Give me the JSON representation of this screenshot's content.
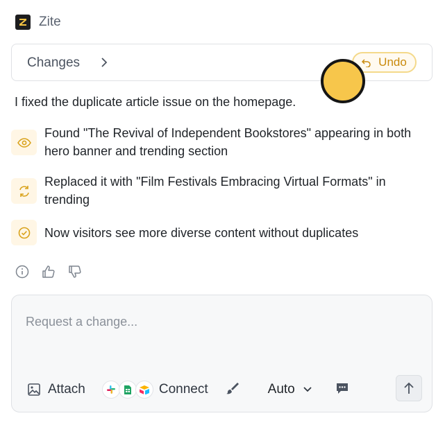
{
  "app": {
    "name": "Zite",
    "logo_icon": "zite-logo-icon"
  },
  "changes": {
    "label": "Changes",
    "undo_label": "Undo"
  },
  "message": {
    "summary": "I fixed the duplicate article issue on the homepage.",
    "items": [
      {
        "icon": "eye-icon",
        "text": "Found \"The Revival of Independent Bookstores\" appearing in both hero banner and trending section"
      },
      {
        "icon": "refresh-icon",
        "text": "Replaced it with \"Film Festivals Embracing Virtual Formats\" in trending"
      },
      {
        "icon": "check-circle-icon",
        "text": "Now visitors see more diverse content without duplicates"
      }
    ]
  },
  "feedback": {
    "icons": [
      "info-icon",
      "thumbs-up-icon",
      "thumbs-down-icon"
    ]
  },
  "composer": {
    "placeholder": "Request a change...",
    "attach_label": "Attach",
    "connect_label": "Connect",
    "mode_label": "Auto",
    "integrations": [
      "slack-icon",
      "sheets-icon",
      "airtable-icon"
    ]
  },
  "colors": {
    "accent": "#c98a0c",
    "accent_bg": "#fff6e5",
    "cursor": "#f7c64b"
  }
}
